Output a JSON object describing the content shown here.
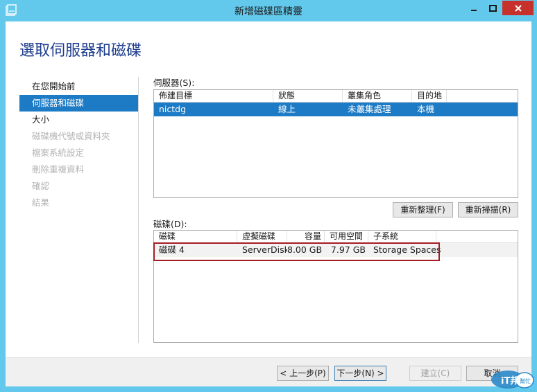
{
  "window": {
    "title": "新增磁碟區精靈",
    "icon": "wizard-app-icon",
    "accent": "#63c9ec",
    "controls": [
      "minimize-icon",
      "maximize-icon",
      "close-icon"
    ]
  },
  "page": {
    "heading": "選取伺服器和磁碟"
  },
  "nav": {
    "items": [
      {
        "label": "在您開始前",
        "state": "normal"
      },
      {
        "label": "伺服器和磁碟",
        "state": "active"
      },
      {
        "label": "大小",
        "state": "normal"
      },
      {
        "label": "磁碟機代號或資料夾",
        "state": "disabled"
      },
      {
        "label": "檔案系統設定",
        "state": "disabled"
      },
      {
        "label": "刪除重複資料",
        "state": "disabled"
      },
      {
        "label": "確認",
        "state": "disabled"
      },
      {
        "label": "結果",
        "state": "disabled"
      }
    ]
  },
  "servers": {
    "label": "伺服器(S):",
    "columns": [
      "佈建目標",
      "狀態",
      "叢集角色",
      "目的地"
    ],
    "rows": [
      {
        "target": "nictdg",
        "status": "線上",
        "role": "未叢集處理",
        "dest": "本機",
        "selected": true
      }
    ]
  },
  "server_buttons": {
    "refresh": "重新整理(F)",
    "rescan": "重新掃描(R)"
  },
  "disks": {
    "label": "磁碟(D):",
    "columns": [
      "磁碟",
      "虛擬磁碟",
      "容量",
      "可用空間",
      "子系統"
    ],
    "rows": [
      {
        "disk": "磁碟 4",
        "vdisk": "ServerDisk",
        "capacity": "8.00 GB",
        "free": "7.97 GB",
        "subsystem": "Storage Spaces"
      }
    ]
  },
  "footer": {
    "prev": "< 上一步(P)",
    "next": "下一步(N) >",
    "create": "建立(C)",
    "cancel": "取消"
  },
  "watermark": {
    "brand": "iT邦",
    "tag": "幫忙"
  },
  "colors": {
    "selection": "#1d7ac4",
    "heading": "#1e3d8f",
    "highlight": "#a51c24",
    "close_button": "#c7312c"
  }
}
